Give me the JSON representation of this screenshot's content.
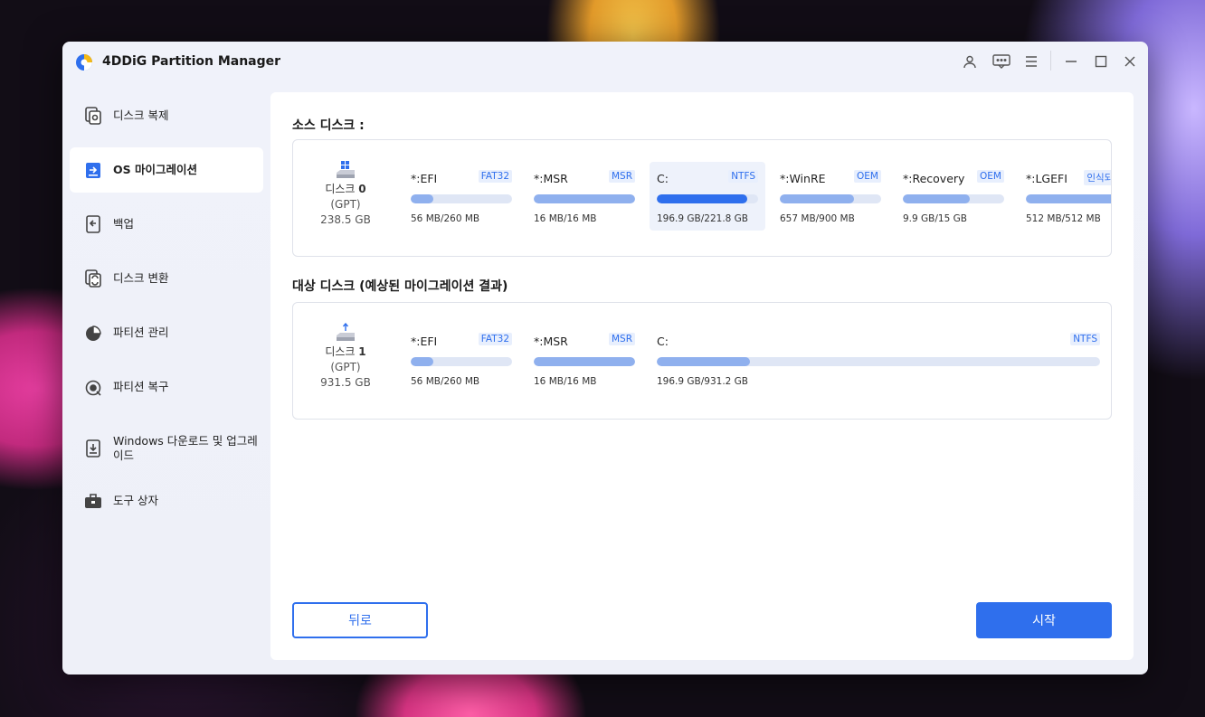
{
  "app": {
    "title": "4DDiG Partition Manager"
  },
  "titlebar": {
    "icons": [
      "account-icon",
      "feedback-icon",
      "menu-icon",
      "minimize-icon",
      "maximize-icon",
      "close-icon"
    ]
  },
  "sidebar": {
    "items": [
      {
        "label": "디스크 복제",
        "icon": "disk-clone-icon",
        "active": false
      },
      {
        "label": "OS 마이그레이션",
        "icon": "os-migration-icon",
        "active": true
      },
      {
        "label": "백업",
        "icon": "backup-icon",
        "active": false
      },
      {
        "label": "디스크 변환",
        "icon": "disk-convert-icon",
        "active": false
      },
      {
        "label": "파티션 관리",
        "icon": "partition-manage-icon",
        "active": false
      },
      {
        "label": "파티션 복구",
        "icon": "partition-recovery-icon",
        "active": false
      },
      {
        "label": "Windows 다운로드 및 업그레이드",
        "icon": "windows-download-icon",
        "active": false
      },
      {
        "label": "도구 상자",
        "icon": "toolbox-icon",
        "active": false
      }
    ]
  },
  "source": {
    "title": "소스 디스크 :",
    "disk": {
      "label": "디스크",
      "number": "0",
      "type": "(GPT)",
      "size": "238.5 GB"
    },
    "partitions": [
      {
        "name": "*:EFI",
        "fs": "FAT32",
        "usage": "56 MB/260 MB",
        "fill": 0.22,
        "selected": false
      },
      {
        "name": "*:MSR",
        "fs": "MSR",
        "usage": "16 MB/16 MB",
        "fill": 1.0,
        "selected": false
      },
      {
        "name": "C:",
        "fs": "NTFS",
        "usage": "196.9 GB/221.8 GB",
        "fill": 0.89,
        "selected": true
      },
      {
        "name": "*:WinRE",
        "fs": "OEM",
        "usage": "657 MB/900 MB",
        "fill": 0.73,
        "selected": false
      },
      {
        "name": "*:Recovery",
        "fs": "OEM",
        "usage": "9.9 GB/15 GB",
        "fill": 0.66,
        "selected": false
      },
      {
        "name": "*:LGEFI",
        "fs": "인식되지 않",
        "usage": "512 MB/512 MB",
        "fill": 1.0,
        "selected": false
      }
    ]
  },
  "target": {
    "title": "대상 디스크 (예상된 마이그레이션 결과)",
    "disk": {
      "label": "디스크",
      "number": "1",
      "type": "(GPT)",
      "size": "931.5 GB"
    },
    "partitions": [
      {
        "name": "*:EFI",
        "fs": "FAT32",
        "usage": "56 MB/260 MB",
        "fill": 0.22
      },
      {
        "name": "*:MSR",
        "fs": "MSR",
        "usage": "16 MB/16 MB",
        "fill": 1.0
      },
      {
        "name": "C:",
        "fs": "NTFS",
        "usage": "196.9 GB/931.2 GB",
        "fill": 0.21
      }
    ]
  },
  "buttons": {
    "back": "뒤로",
    "start": "시작"
  },
  "colors": {
    "accent": "#2f6fed",
    "bar_track": "#dfe6f5",
    "bar_fill": "#8fb0ee"
  }
}
